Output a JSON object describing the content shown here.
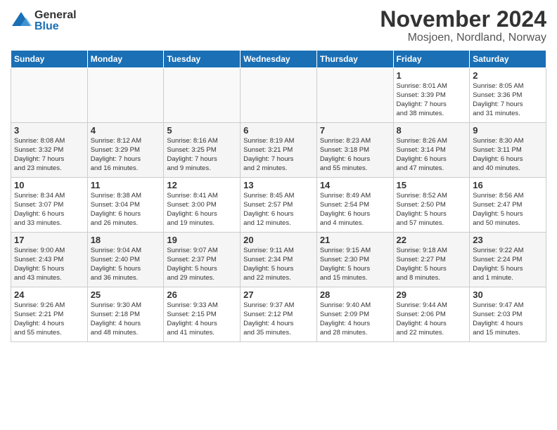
{
  "logo": {
    "general": "General",
    "blue": "Blue"
  },
  "title": "November 2024",
  "location": "Mosjoen, Nordland, Norway",
  "headers": [
    "Sunday",
    "Monday",
    "Tuesday",
    "Wednesday",
    "Thursday",
    "Friday",
    "Saturday"
  ],
  "weeks": [
    [
      {
        "day": "",
        "info": ""
      },
      {
        "day": "",
        "info": ""
      },
      {
        "day": "",
        "info": ""
      },
      {
        "day": "",
        "info": ""
      },
      {
        "day": "",
        "info": ""
      },
      {
        "day": "1",
        "info": "Sunrise: 8:01 AM\nSunset: 3:39 PM\nDaylight: 7 hours\nand 38 minutes."
      },
      {
        "day": "2",
        "info": "Sunrise: 8:05 AM\nSunset: 3:36 PM\nDaylight: 7 hours\nand 31 minutes."
      }
    ],
    [
      {
        "day": "3",
        "info": "Sunrise: 8:08 AM\nSunset: 3:32 PM\nDaylight: 7 hours\nand 23 minutes."
      },
      {
        "day": "4",
        "info": "Sunrise: 8:12 AM\nSunset: 3:29 PM\nDaylight: 7 hours\nand 16 minutes."
      },
      {
        "day": "5",
        "info": "Sunrise: 8:16 AM\nSunset: 3:25 PM\nDaylight: 7 hours\nand 9 minutes."
      },
      {
        "day": "6",
        "info": "Sunrise: 8:19 AM\nSunset: 3:21 PM\nDaylight: 7 hours\nand 2 minutes."
      },
      {
        "day": "7",
        "info": "Sunrise: 8:23 AM\nSunset: 3:18 PM\nDaylight: 6 hours\nand 55 minutes."
      },
      {
        "day": "8",
        "info": "Sunrise: 8:26 AM\nSunset: 3:14 PM\nDaylight: 6 hours\nand 47 minutes."
      },
      {
        "day": "9",
        "info": "Sunrise: 8:30 AM\nSunset: 3:11 PM\nDaylight: 6 hours\nand 40 minutes."
      }
    ],
    [
      {
        "day": "10",
        "info": "Sunrise: 8:34 AM\nSunset: 3:07 PM\nDaylight: 6 hours\nand 33 minutes."
      },
      {
        "day": "11",
        "info": "Sunrise: 8:38 AM\nSunset: 3:04 PM\nDaylight: 6 hours\nand 26 minutes."
      },
      {
        "day": "12",
        "info": "Sunrise: 8:41 AM\nSunset: 3:00 PM\nDaylight: 6 hours\nand 19 minutes."
      },
      {
        "day": "13",
        "info": "Sunrise: 8:45 AM\nSunset: 2:57 PM\nDaylight: 6 hours\nand 12 minutes."
      },
      {
        "day": "14",
        "info": "Sunrise: 8:49 AM\nSunset: 2:54 PM\nDaylight: 6 hours\nand 4 minutes."
      },
      {
        "day": "15",
        "info": "Sunrise: 8:52 AM\nSunset: 2:50 PM\nDaylight: 5 hours\nand 57 minutes."
      },
      {
        "day": "16",
        "info": "Sunrise: 8:56 AM\nSunset: 2:47 PM\nDaylight: 5 hours\nand 50 minutes."
      }
    ],
    [
      {
        "day": "17",
        "info": "Sunrise: 9:00 AM\nSunset: 2:43 PM\nDaylight: 5 hours\nand 43 minutes."
      },
      {
        "day": "18",
        "info": "Sunrise: 9:04 AM\nSunset: 2:40 PM\nDaylight: 5 hours\nand 36 minutes."
      },
      {
        "day": "19",
        "info": "Sunrise: 9:07 AM\nSunset: 2:37 PM\nDaylight: 5 hours\nand 29 minutes."
      },
      {
        "day": "20",
        "info": "Sunrise: 9:11 AM\nSunset: 2:34 PM\nDaylight: 5 hours\nand 22 minutes."
      },
      {
        "day": "21",
        "info": "Sunrise: 9:15 AM\nSunset: 2:30 PM\nDaylight: 5 hours\nand 15 minutes."
      },
      {
        "day": "22",
        "info": "Sunrise: 9:18 AM\nSunset: 2:27 PM\nDaylight: 5 hours\nand 8 minutes."
      },
      {
        "day": "23",
        "info": "Sunrise: 9:22 AM\nSunset: 2:24 PM\nDaylight: 5 hours\nand 1 minute."
      }
    ],
    [
      {
        "day": "24",
        "info": "Sunrise: 9:26 AM\nSunset: 2:21 PM\nDaylight: 4 hours\nand 55 minutes."
      },
      {
        "day": "25",
        "info": "Sunrise: 9:30 AM\nSunset: 2:18 PM\nDaylight: 4 hours\nand 48 minutes."
      },
      {
        "day": "26",
        "info": "Sunrise: 9:33 AM\nSunset: 2:15 PM\nDaylight: 4 hours\nand 41 minutes."
      },
      {
        "day": "27",
        "info": "Sunrise: 9:37 AM\nSunset: 2:12 PM\nDaylight: 4 hours\nand 35 minutes."
      },
      {
        "day": "28",
        "info": "Sunrise: 9:40 AM\nSunset: 2:09 PM\nDaylight: 4 hours\nand 28 minutes."
      },
      {
        "day": "29",
        "info": "Sunrise: 9:44 AM\nSunset: 2:06 PM\nDaylight: 4 hours\nand 22 minutes."
      },
      {
        "day": "30",
        "info": "Sunrise: 9:47 AM\nSunset: 2:03 PM\nDaylight: 4 hours\nand 15 minutes."
      }
    ]
  ]
}
